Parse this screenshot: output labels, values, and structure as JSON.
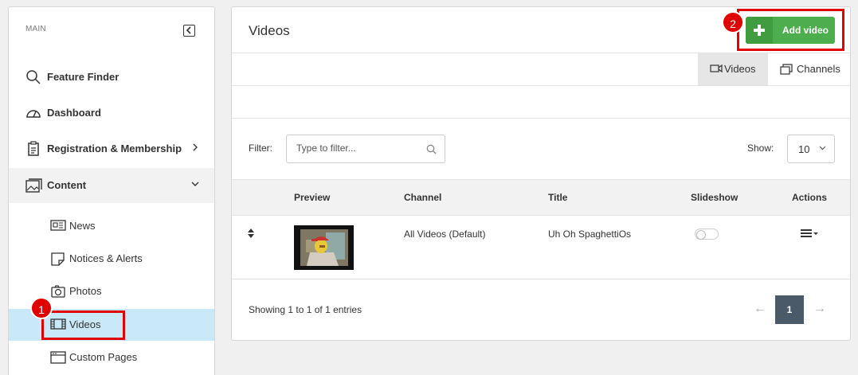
{
  "sidebar": {
    "section_label": "MAIN",
    "items": [
      {
        "label": "Feature Finder",
        "icon": "search-icon"
      },
      {
        "label": "Dashboard",
        "icon": "dashboard-icon"
      },
      {
        "label": "Registration & Membership",
        "icon": "clipboard-icon"
      },
      {
        "label": "Content",
        "icon": "content-icon"
      }
    ],
    "sub_items": [
      {
        "label": "News",
        "icon": "newspaper-icon"
      },
      {
        "label": "Notices & Alerts",
        "icon": "note-icon"
      },
      {
        "label": "Photos",
        "icon": "camera-icon"
      },
      {
        "label": "Videos",
        "icon": "film-icon",
        "active": true
      },
      {
        "label": "Custom Pages",
        "icon": "browser-icon"
      }
    ]
  },
  "main": {
    "title": "Videos",
    "add_button": "Add video",
    "tabs": [
      {
        "label": "Videos",
        "active": true
      },
      {
        "label": "Channels",
        "active": false
      }
    ],
    "filter": {
      "label": "Filter:",
      "placeholder": "Type to filter..."
    },
    "show": {
      "label": "Show:",
      "value": "10"
    },
    "table": {
      "columns": [
        "Preview",
        "Channel",
        "Title",
        "Slideshow",
        "Actions"
      ],
      "rows": [
        {
          "channel": "All Videos (Default)",
          "title": "Uh Oh SpaghettiOs",
          "slideshow": false
        }
      ]
    },
    "footer": {
      "showing": "Showing 1 to 1 of 1 entries",
      "page": "1",
      "prev": "←",
      "next": "→"
    }
  },
  "annotations": {
    "badge1": "1",
    "badge2": "2"
  },
  "colors": {
    "accent_green": "#4cae4c",
    "active_bg": "#c9e9f8",
    "callout": "#e00000",
    "page_button": "#4a5a68"
  }
}
